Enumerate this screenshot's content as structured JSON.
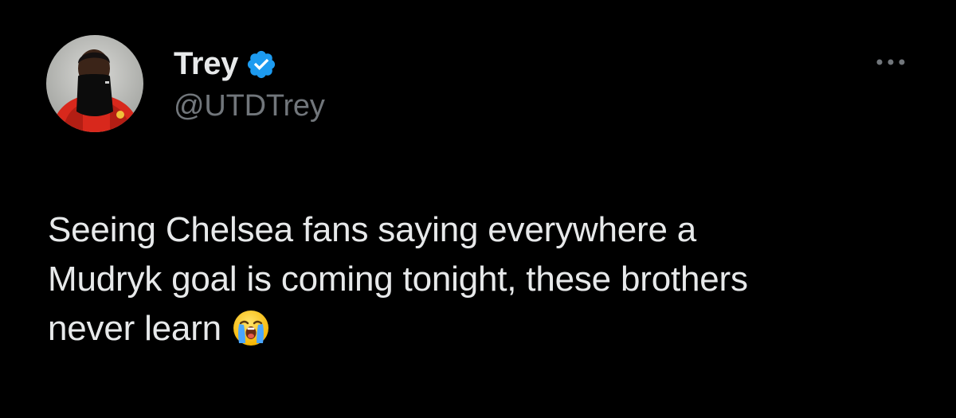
{
  "tweet": {
    "author": {
      "display_name": "Trey",
      "handle": "@UTDTrey",
      "verified": true
    },
    "text_lines": [
      "Seeing Chelsea fans saying everywhere a",
      "Mudryk goal is coming tonight, these brothers",
      "never learn"
    ],
    "emoji": "loudly-crying-face-emoji"
  },
  "icons": {
    "verified": "verified-badge-icon",
    "more": "more-options-icon",
    "emoji": "loudly-crying-face-icon"
  },
  "colors": {
    "background": "#000000",
    "primary_text": "#e7e9ea",
    "secondary_text": "#71767b",
    "verified_blue": "#1d9bf0"
  }
}
